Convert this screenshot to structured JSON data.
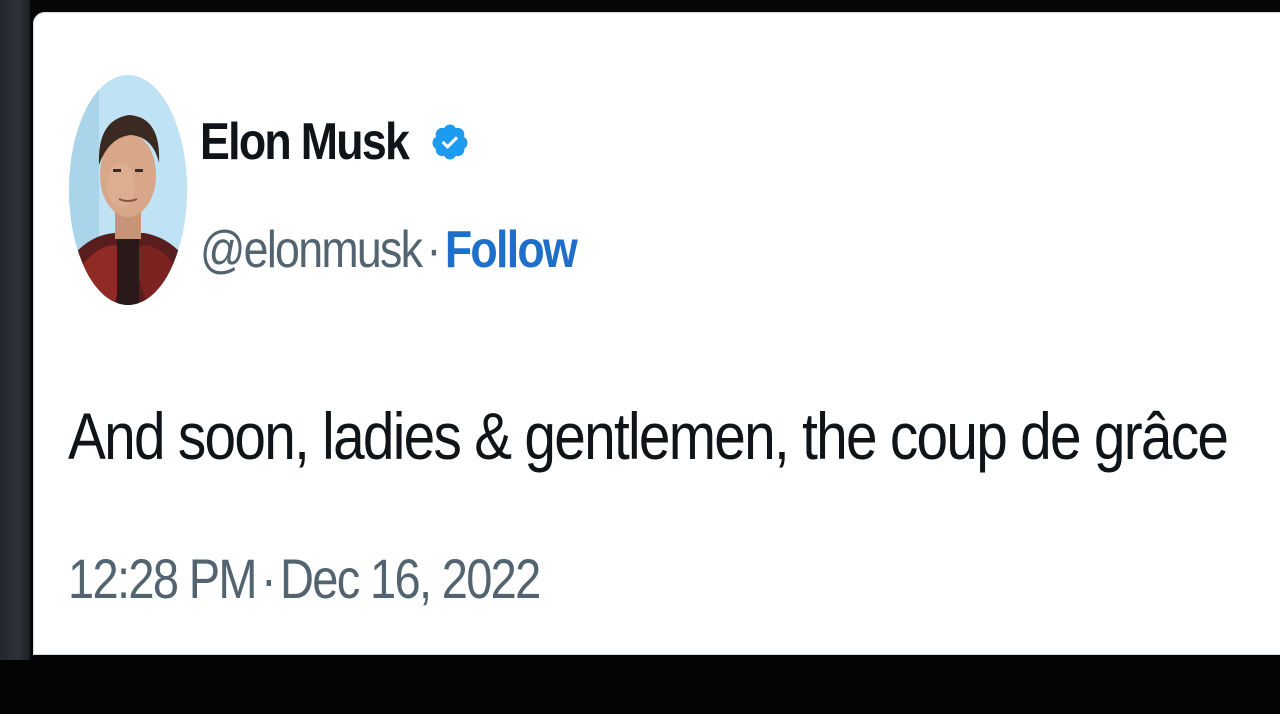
{
  "tweet": {
    "author": {
      "display_name": "Elon Musk",
      "handle": "@elonmusk",
      "verified": true,
      "verified_icon": "verified-badge-icon",
      "avatar_icon": "profile-photo"
    },
    "separator": "·",
    "follow_label": "Follow",
    "text": "And soon, ladies & gentlemen, the coup de grâce",
    "time": "12:28 PM",
    "date": "Dec 16, 2022"
  },
  "colors": {
    "text_primary": "#0f1419",
    "text_secondary": "#536471",
    "accent": "#1d6fc9",
    "verified": "#1d9bf0",
    "card_background": "#ffffff",
    "frame_background": "#050608"
  }
}
